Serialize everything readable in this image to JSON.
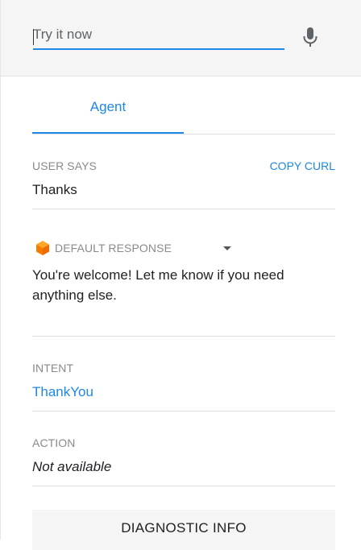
{
  "test_console": {
    "input": {
      "placeholder": "Try it now",
      "value": ""
    },
    "mic_icon": "microphone-icon"
  },
  "tabs": [
    {
      "label": "Agent",
      "active": true
    }
  ],
  "user_says": {
    "label": "USER SAYS",
    "copy_curl": "COPY CURL",
    "value": "Thanks"
  },
  "response": {
    "label": "DEFAULT RESPONSE",
    "icon": "default-response-cube-icon",
    "icon_color": "#f57c00",
    "text": "You're welcome! Let me know if you need anything else."
  },
  "intent": {
    "label": "INTENT",
    "value": "ThankYou"
  },
  "action": {
    "label": "ACTION",
    "value": "Not available"
  },
  "diagnostic_button": "DIAGNOSTIC INFO",
  "colors": {
    "accent": "#1e88e5",
    "topbar_bg": "#f5f5f5"
  }
}
